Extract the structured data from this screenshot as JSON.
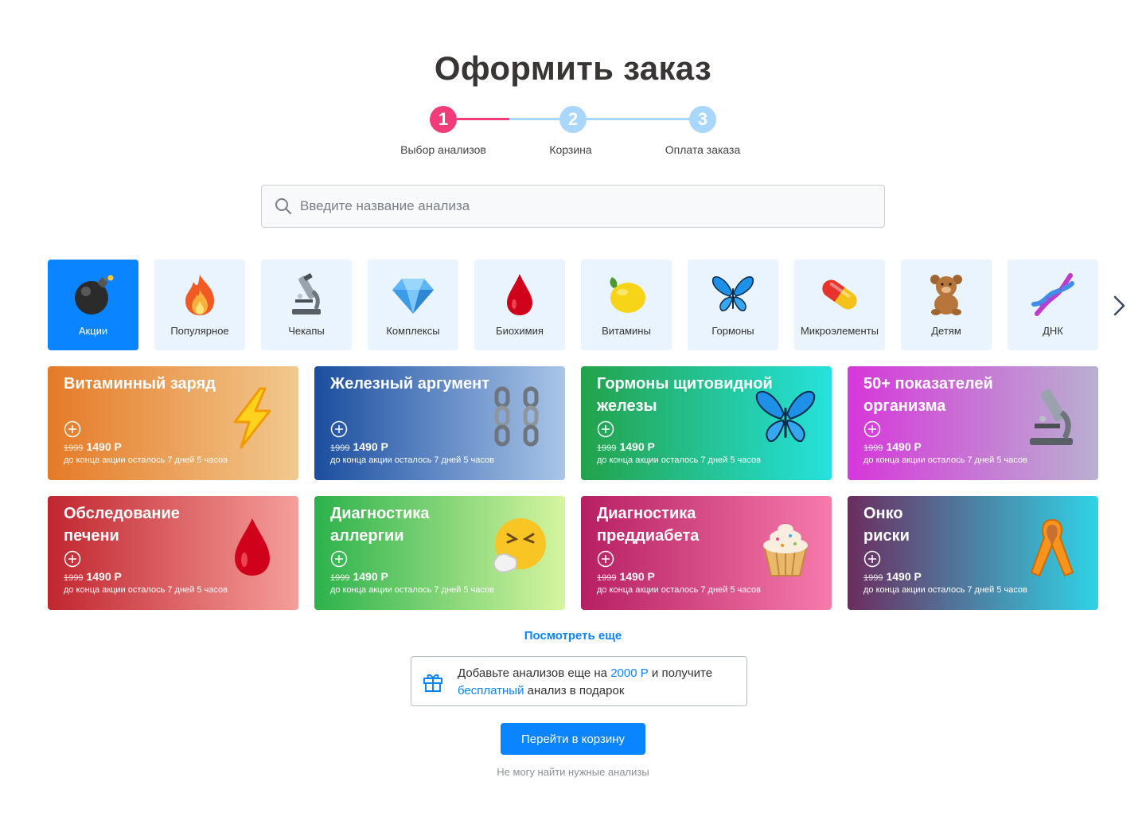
{
  "page_title": "Оформить заказ",
  "stepper": {
    "steps": [
      {
        "number": "1",
        "label": "Выбор анализов",
        "active": true
      },
      {
        "number": "2",
        "label": "Корзина",
        "active": false
      },
      {
        "number": "3",
        "label": "Оплата заказа",
        "active": false
      }
    ],
    "colors": {
      "active": "#f03c78",
      "inactive": "#a9d6fb"
    }
  },
  "search": {
    "placeholder": "Введите название анализа",
    "value": "",
    "icon": "search-icon"
  },
  "categories": [
    {
      "label": "Акции",
      "icon": "bomb-icon",
      "active": true
    },
    {
      "label": "Популярное",
      "icon": "fire-icon",
      "active": false
    },
    {
      "label": "Чекапы",
      "icon": "microscope-icon",
      "active": false
    },
    {
      "label": "Комплексы",
      "icon": "diamond-icon",
      "active": false
    },
    {
      "label": "Биохимия",
      "icon": "blood-drop-icon",
      "active": false
    },
    {
      "label": "Витамины",
      "icon": "lemon-icon",
      "active": false
    },
    {
      "label": "Гормоны",
      "icon": "butterfly-icon",
      "active": false
    },
    {
      "label": "Микроэлементы",
      "icon": "pill-icon",
      "active": false
    },
    {
      "label": "Детям",
      "icon": "teddy-bear-icon",
      "active": false
    },
    {
      "label": "ДНК",
      "icon": "dna-icon",
      "active": false
    }
  ],
  "promos": [
    {
      "title": "Витаминный заряд",
      "old_price": "1999",
      "price": "1490 Р",
      "timer": "до конца акции осталось 7 дней 5 часов",
      "icon": "lightning-icon",
      "gradient": [
        "#e57a27",
        "#f1c98e"
      ]
    },
    {
      "title": "Железный аргумент",
      "old_price": "1999",
      "price": "1490 Р",
      "timer": "до конца акции осталось 7 дней 5 часов",
      "icon": "chains-icon",
      "gradient": [
        "#1b4ea0",
        "#a9c5e8"
      ]
    },
    {
      "title": "Гормоны щитовидной железы",
      "old_price": "1999",
      "price": "1490 Р",
      "timer": "до конца акции осталось 7 дней 5 часов",
      "icon": "butterfly-icon",
      "gradient": [
        "#23a24a",
        "#25e2dc"
      ]
    },
    {
      "title": "50+ показателей организма",
      "old_price": "1999",
      "price": "1490 Р",
      "timer": "до конца акции осталось 7 дней 5 часов",
      "icon": "microscope-icon",
      "gradient": [
        "#d637d9",
        "#b9b0d1"
      ]
    },
    {
      "title": "Обследование печени",
      "old_price": "1999",
      "price": "1490 Р",
      "timer": "до конца акции осталось 7 дней 5 часов",
      "icon": "blood-drop-icon",
      "gradient": [
        "#c1262f",
        "#f59e9a"
      ]
    },
    {
      "title": "Диагностика аллергии",
      "old_price": "1999",
      "price": "1490 Р",
      "timer": "до конца акции осталось 7 дней 5 часов",
      "icon": "sneezing-face-icon",
      "gradient": [
        "#2bb24b",
        "#d6f5a0"
      ]
    },
    {
      "title": "Диагностика преддиабета",
      "old_price": "1999",
      "price": "1490 Р",
      "timer": "до конца акции осталось 7 дней 5 часов",
      "icon": "cupcake-icon",
      "gradient": [
        "#b71f63",
        "#f67bab"
      ]
    },
    {
      "title": "Онко риски",
      "old_price": "1999",
      "price": "1490 Р",
      "timer": "до конца акции осталось 7 дней 5 часов",
      "icon": "ribbon-icon",
      "gradient": [
        "#6b2d5f",
        "#2fd3e6"
      ]
    }
  ],
  "show_more_label": "Посмотреть еще",
  "gift_banner": {
    "text_before": "Добавьте анализов еще на ",
    "amount": "2000 Р",
    "text_middle": " и получите ",
    "free_word": "бесплатный",
    "text_after": " анализ в подарок",
    "icon": "gift-icon"
  },
  "cart_button_label": "Перейти в корзину",
  "cant_find_label": "Не могу найти нужные анализы",
  "colors": {
    "accent": "#0a84ff",
    "category_bg": "#e9f4fe"
  }
}
